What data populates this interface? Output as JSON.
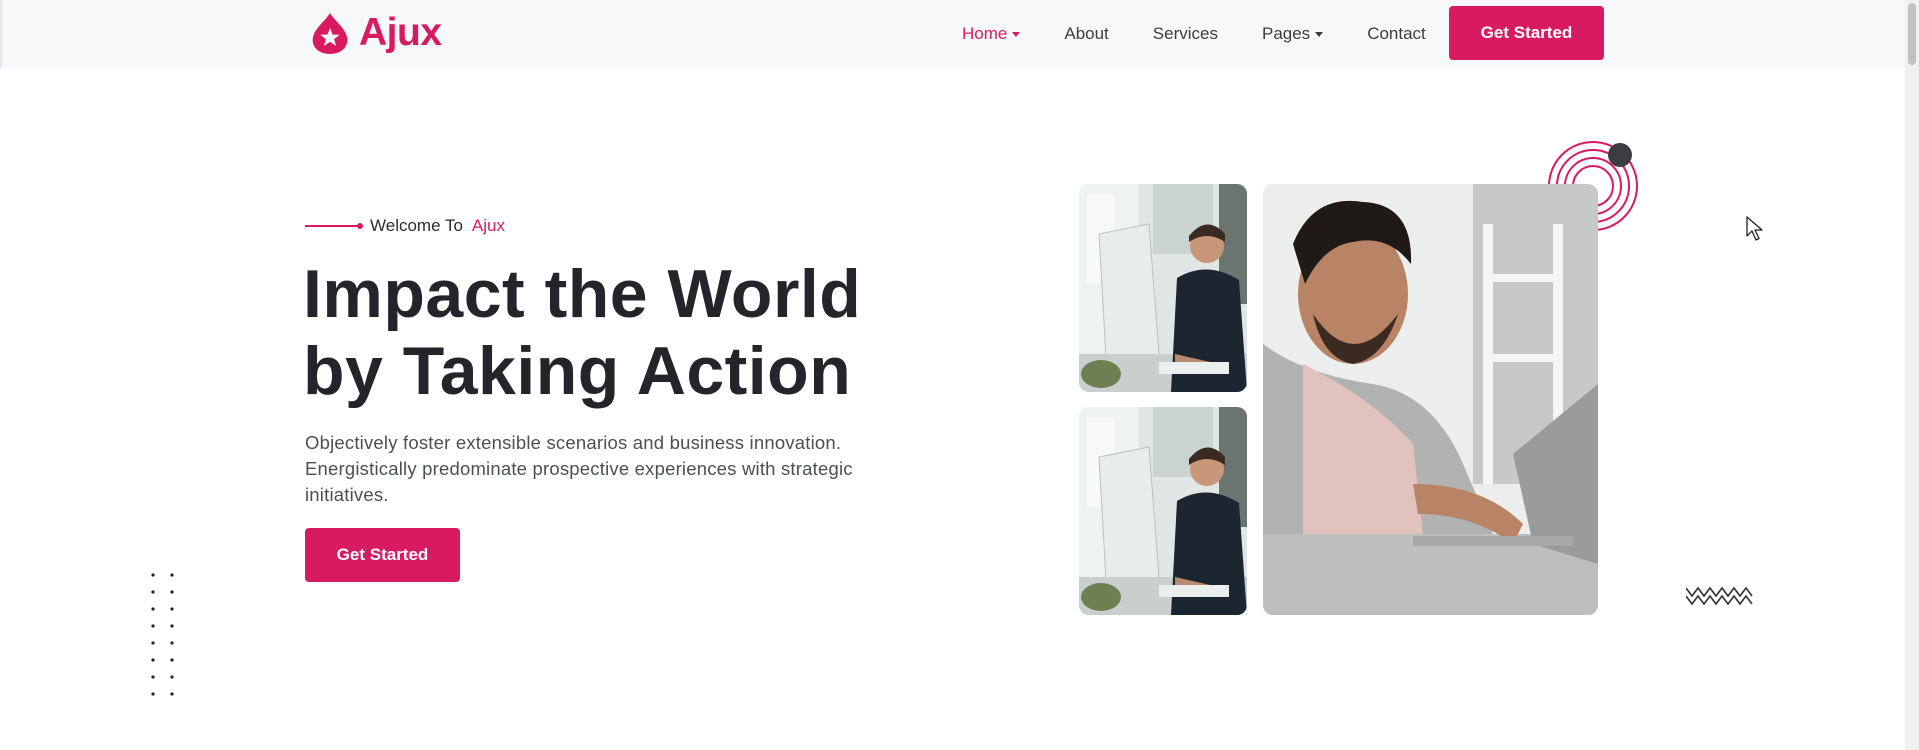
{
  "brand": {
    "name": "Ajux",
    "accent_color": "#d81b60",
    "logo_icon": "star-drop-icon"
  },
  "nav": {
    "items": [
      {
        "label": "Home",
        "active": true,
        "dropdown": true
      },
      {
        "label": "About",
        "active": false,
        "dropdown": false
      },
      {
        "label": "Services",
        "active": false,
        "dropdown": false
      },
      {
        "label": "Pages",
        "active": false,
        "dropdown": true
      },
      {
        "label": "Contact",
        "active": false,
        "dropdown": false
      }
    ],
    "cta_label": "Get Started"
  },
  "hero": {
    "eyebrow_prefix": "Welcome To",
    "eyebrow_brand": "Ajux",
    "title_line1": "Impact the World",
    "title_line2": "by Taking Action",
    "description": "Objectively foster extensible scenarios and business innovation. Energistically predominate prospective experiences with strategic initiatives.",
    "cta_label": "Get Started"
  },
  "images": [
    {
      "name": "man-at-desktop-photo",
      "alt": "Man working at desktop computer"
    },
    {
      "name": "man-at-desktop-photo",
      "alt": "Man working at desktop computer"
    },
    {
      "name": "man-with-laptop-photo",
      "alt": "Smiling man typing on laptop"
    }
  ]
}
